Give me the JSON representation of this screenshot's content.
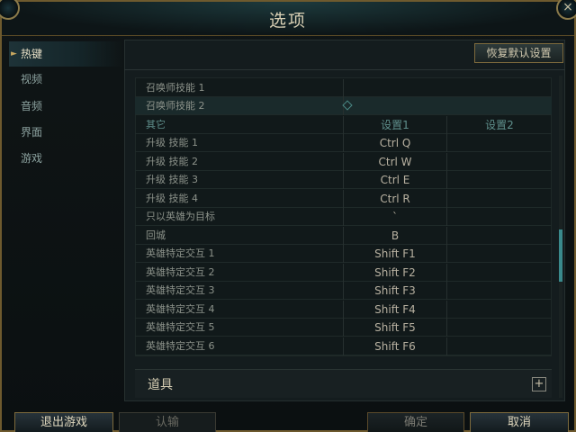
{
  "window": {
    "title": "选项",
    "close_label": "×"
  },
  "sidebar": {
    "items": [
      {
        "label": "热键",
        "active": true
      },
      {
        "label": "视频"
      },
      {
        "label": "音频"
      },
      {
        "label": "界面"
      },
      {
        "label": "游戏"
      }
    ]
  },
  "toolbar": {
    "reset_label": "恢复默认设置"
  },
  "summoner_spells": [
    {
      "label": "召唤师技能 1"
    },
    {
      "label": "召唤师技能 2"
    }
  ],
  "table": {
    "headers": [
      "其它",
      "设置1",
      "设置2"
    ],
    "rows": [
      {
        "label": "升级 技能 1",
        "key1": "Ctrl  Q",
        "key2": ""
      },
      {
        "label": "升级 技能 2",
        "key1": "Ctrl  W",
        "key2": ""
      },
      {
        "label": "升级 技能 3",
        "key1": "Ctrl  E",
        "key2": ""
      },
      {
        "label": "升级 技能 4",
        "key1": "Ctrl  R",
        "key2": ""
      },
      {
        "label": "只以英雄为目标",
        "key1": "`",
        "key2": ""
      },
      {
        "label": "回城",
        "key1": "B",
        "key2": ""
      },
      {
        "label": "英雄特定交互 1",
        "key1": "Shift  F1",
        "key2": ""
      },
      {
        "label": "英雄特定交互 2",
        "key1": "Shift  F2",
        "key2": ""
      },
      {
        "label": "英雄特定交互 3",
        "key1": "Shift  F3",
        "key2": ""
      },
      {
        "label": "英雄特定交互 4",
        "key1": "Shift  F4",
        "key2": ""
      },
      {
        "label": "英雄特定交互 5",
        "key1": "Shift  F5",
        "key2": ""
      },
      {
        "label": "英雄特定交互 6",
        "key1": "Shift  F6",
        "key2": ""
      }
    ]
  },
  "section": {
    "label": "道具",
    "expand_label": "+"
  },
  "footer": {
    "exit_label": "退出游戏",
    "surrender_label": "认输",
    "confirm_label": "确定",
    "cancel_label": "取消"
  },
  "colors": {
    "accent_gold": "#c8aa6e",
    "accent_teal": "#3a8a8c",
    "background": "#0b1011"
  }
}
